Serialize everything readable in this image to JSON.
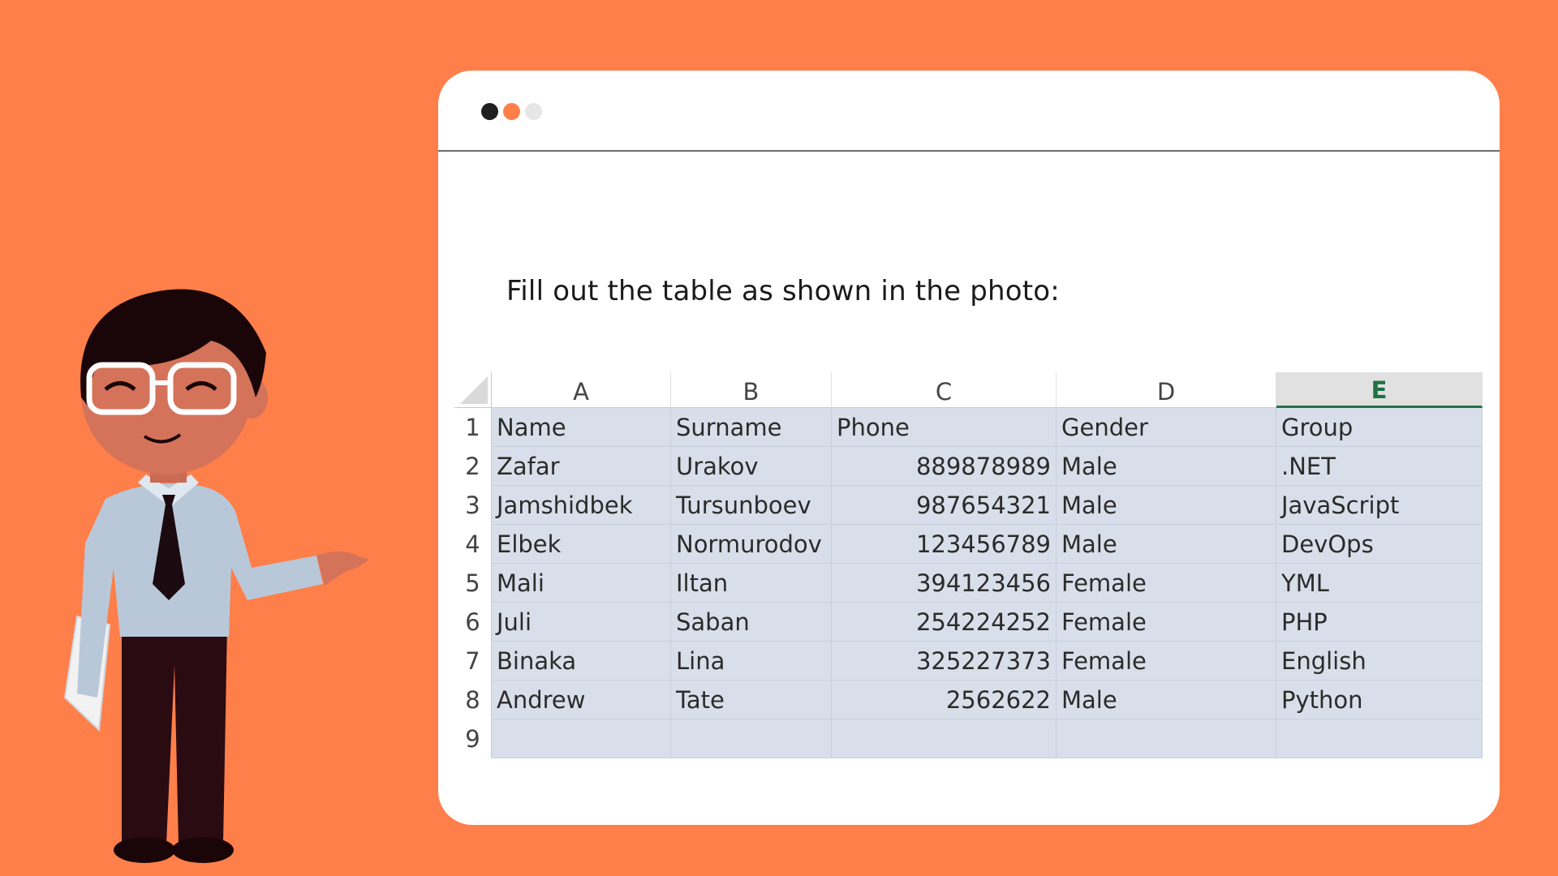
{
  "instruction": "Fill out the table as shown in the photo:",
  "sheet": {
    "columns": [
      "A",
      "B",
      "C",
      "D",
      "E"
    ],
    "active_column": "E",
    "row_numbers": [
      "1",
      "2",
      "3",
      "4",
      "5",
      "6",
      "7",
      "8",
      "9"
    ],
    "rows": [
      [
        "Name",
        "Surname",
        "Phone",
        "Gender",
        "Group"
      ],
      [
        "Zafar",
        "Urakov",
        "889878989",
        "Male",
        ".NET"
      ],
      [
        "Jamshidbek",
        "Tursunboev",
        "987654321",
        "Male",
        "JavaScript"
      ],
      [
        "Elbek",
        "Normurodov",
        "123456789",
        "Male",
        "DevOps"
      ],
      [
        "Mali",
        "Iltan",
        "394123456",
        "Female",
        "YML"
      ],
      [
        "Juli",
        "Saban",
        "254224252",
        "Female",
        "PHP"
      ],
      [
        "Binaka",
        "Lina",
        "325227373",
        "Female",
        "English"
      ],
      [
        "Andrew",
        "Tate",
        "2562622",
        "Male",
        "Python"
      ],
      [
        "",
        "",
        "",
        "",
        ""
      ]
    ]
  },
  "colors": {
    "background": "#FF7F4A",
    "window": "#FFFFFF",
    "cell_fill": "#D9DFEA",
    "active_header_text": "#1E7145",
    "window_dots": [
      "#1F1F1F",
      "#FF7F4A",
      "#E6E6E6"
    ]
  },
  "illustration": "cartoon-teacher-presenting"
}
